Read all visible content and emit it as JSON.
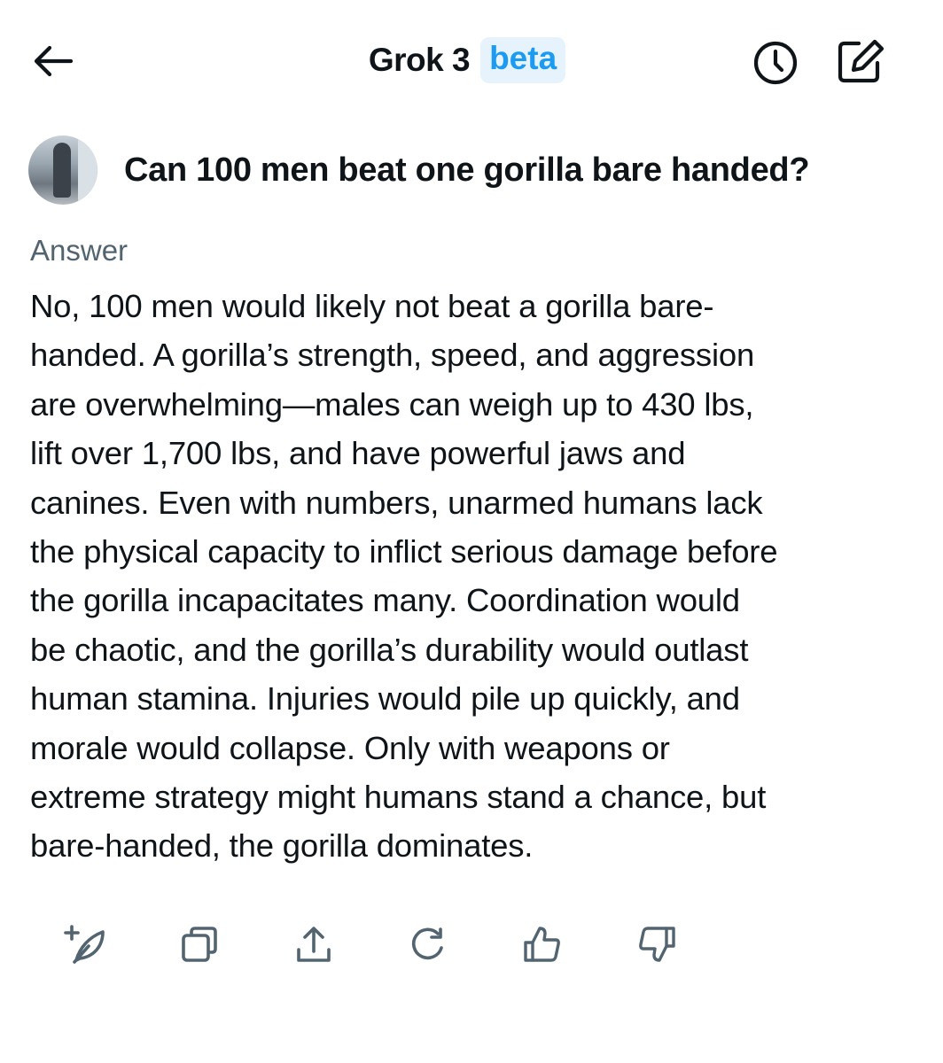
{
  "header": {
    "title": "Grok 3",
    "badge": "beta",
    "back_icon": "arrow-left-icon",
    "history_icon": "clock-icon",
    "compose_icon": "compose-icon"
  },
  "question": {
    "text": "Can 100 men beat one gorilla bare handed?"
  },
  "answer": {
    "label": "Answer",
    "lines": [
      "No, 100 men would likely not beat a gorilla bare-",
      "handed. A gorilla’s strength, speed, and aggression",
      "are overwhelming—males can weigh up to 430 lbs,",
      "lift over 1,700 lbs, and have powerful jaws and",
      "canines. Even with numbers, unarmed humans lack",
      "the physical capacity to inflict serious damage before",
      "the gorilla incapacitates many. Coordination would",
      "be chaotic, and the gorilla’s durability would outlast",
      "human stamina. Injuries would pile up quickly, and",
      "morale would collapse. Only with weapons or",
      "extreme strategy might humans stand a chance, but",
      "bare-handed, the gorilla dominates."
    ]
  },
  "actions": [
    {
      "icon": "feather-plus-icon"
    },
    {
      "icon": "copy-icon"
    },
    {
      "icon": "share-icon"
    },
    {
      "icon": "regenerate-icon"
    },
    {
      "icon": "thumbs-up-icon"
    },
    {
      "icon": "thumbs-down-icon"
    }
  ],
  "colors": {
    "text": "#0f1419",
    "secondary": "#536471",
    "accent": "#1d9bf0",
    "badge_bg": "#e6f3fd"
  }
}
